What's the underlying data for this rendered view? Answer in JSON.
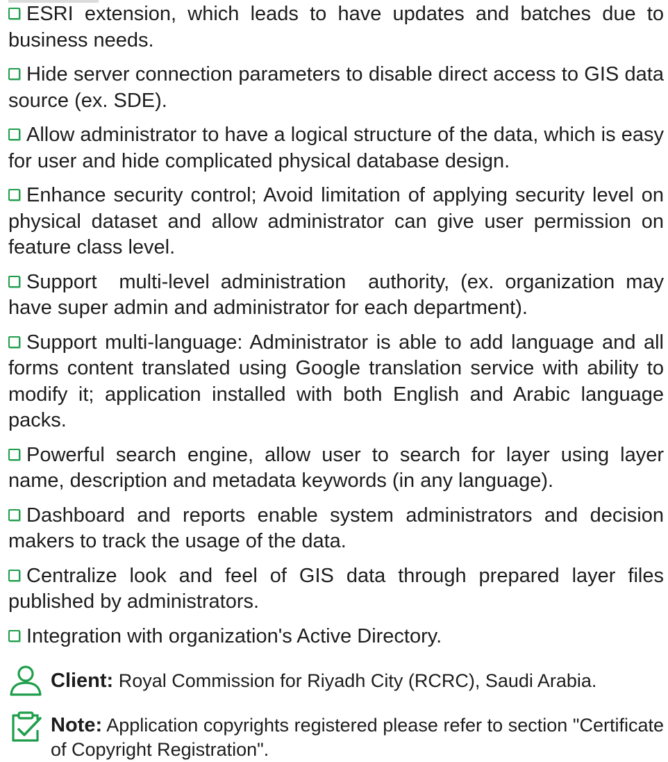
{
  "bullets": [
    "ESRI extension, which leads to have updates and batches due to business needs.",
    "Hide server connection parameters to disable direct access to GIS data source (ex. SDE).",
    "Allow administrator to have a logical structure of the data, which is easy for user and hide complicated physical database design.",
    "Enhance security control; Avoid limitation of applying security level on physical dataset and allow administrator can give user permission on feature class level.",
    "Support  multi-level administration  authority, (ex. organization may have super admin and administrator for each department).",
    "Support multi-language: Administrator is able to add language and all forms content translated using Google translation service with ability to modify it; application installed with both English and Arabic language packs.",
    "Powerful search engine, allow user to search for layer using layer name, description and metadata keywords (in any language).",
    "Dashboard and reports enable system administrators and decision makers to track the usage of the data.",
    "Centralize look and feel of GIS data through prepared layer files published by administrators.",
    "Integration with organization's Active Directory."
  ],
  "client": {
    "label": "Client:",
    "text": " Royal Commission for Riyadh City (RCRC), Saudi Arabia.",
    "icon": "user-icon"
  },
  "note": {
    "label": "Note:",
    "text": " Application copyrights registered please refer to section \"Certificate of Copyright Registration\".",
    "icon": "clipboard-check-icon"
  },
  "colors": {
    "accent": "#1e9e4b",
    "text": "#1c1c1c"
  }
}
